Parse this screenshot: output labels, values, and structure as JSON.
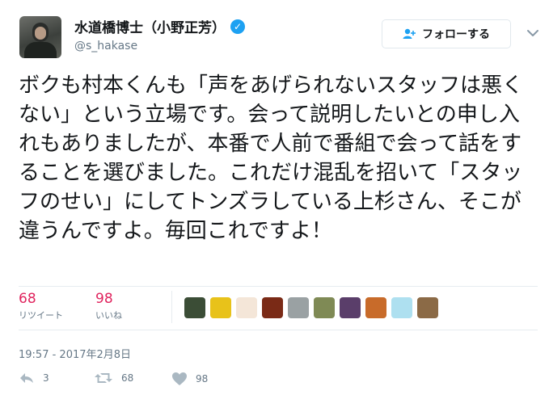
{
  "author": {
    "name": "水道橋博士（小野正芳）",
    "handle": "@s_hakase",
    "verified_glyph": "✓"
  },
  "follow_button": {
    "label": "フォローする",
    "icon": "add-user-icon"
  },
  "tweet": {
    "text": "ボクも村本くんも「声をあげられないスタッフは悪くない」という立場です。会って説明したいとの申し入れもありましたが、本番で人前で番組で会って話をすることを選びました。これだけ混乱を招いて「スタッフのせい」にしてトンズラしている上杉さん、そこが違うんですよ。毎回これですよ！"
  },
  "stats": {
    "retweets": {
      "count": "68",
      "label": "リツイート"
    },
    "likes": {
      "count": "98",
      "label": "いいね"
    }
  },
  "likers": [
    {
      "color": "#3b4d36"
    },
    {
      "color": "#e8c21a"
    },
    {
      "color": "#f4e6d8"
    },
    {
      "color": "#7a2a16"
    },
    {
      "color": "#9aa1a3"
    },
    {
      "color": "#7f8a55"
    },
    {
      "color": "#5a3e6a"
    },
    {
      "color": "#c86b2a"
    },
    {
      "color": "#aee0f0"
    },
    {
      "color": "#8b6a46"
    }
  ],
  "timestamp": "19:57 - 2017年2月8日",
  "actions": {
    "reply": {
      "icon": "reply-icon",
      "count": "3"
    },
    "retweet": {
      "icon": "retweet-icon",
      "count": "68"
    },
    "like": {
      "icon": "heart-icon",
      "count": "98"
    }
  },
  "colors": {
    "accent": "#1da1f2",
    "like": "#e0245e",
    "muted": "#657786",
    "text": "#14171a"
  }
}
